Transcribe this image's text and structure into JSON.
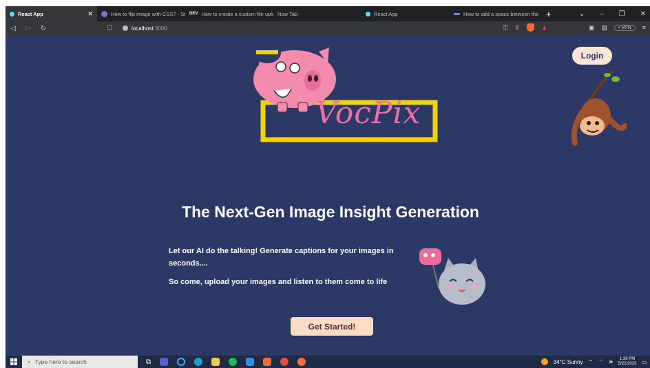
{
  "browser": {
    "tabs": [
      {
        "title": "React App",
        "active": true,
        "favicon_color": "#61dafb"
      },
      {
        "title": "How to flip image with CSS? - St",
        "active": false,
        "favicon_color": "#8e6ad8"
      },
      {
        "title": "How to create a custom file uplo",
        "active": false,
        "favicon_color": "#ffffff"
      },
      {
        "title": "New Tab",
        "active": false,
        "favicon_color": "#202124"
      },
      {
        "title": "React App",
        "active": false,
        "favicon_color": "#61dafb"
      },
      {
        "title": "How to add a space between the",
        "active": false,
        "favicon_color": "#5b8def"
      }
    ],
    "tab_tag_dev": "DEV",
    "new_tab_label": "+",
    "url_host": "localhost",
    "url_port": ":3000",
    "vpn_label": "• VPN"
  },
  "page": {
    "login_label": "Login",
    "logo_text": "VocPix",
    "hero_title": "The Next-Gen Image Insight Generation",
    "hero_p1": "Let our AI do the talking! Generate captions for your images in seconds....",
    "hero_p2": "So come, upload your images and listen to them come to life",
    "cta_label": "Get Started!"
  },
  "taskbar": {
    "search_placeholder": "Type here to search",
    "weather": "34°C  Sunny",
    "time": "1:38 PM",
    "date": "5/22/2023"
  },
  "colors": {
    "page_bg": "#2c3865",
    "accent_button": "#f8dcc4",
    "logo_pink": "#ef6fa4",
    "logo_yellow": "#f2d20c"
  }
}
